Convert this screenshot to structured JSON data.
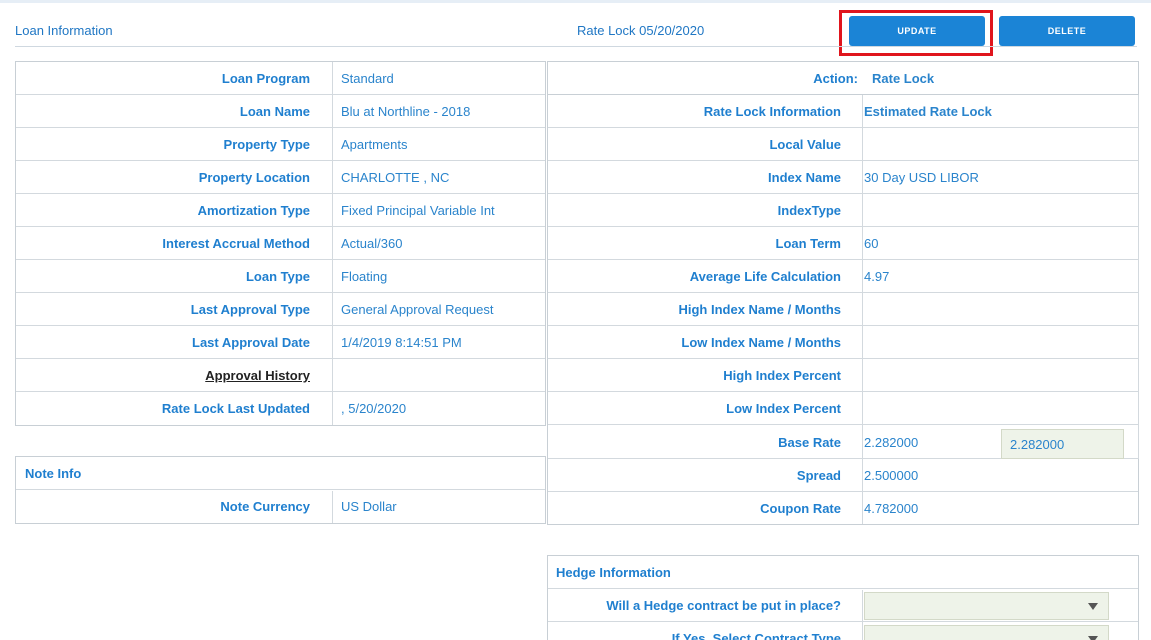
{
  "header": {
    "title": "Loan Information",
    "subtitle": "Rate Lock 05/20/2020",
    "update_label": "UPDATE",
    "delete_label": "DELETE"
  },
  "loan": {
    "rows": [
      {
        "label": "Loan Program",
        "value": "Standard"
      },
      {
        "label": "Loan Name",
        "value": "Blu at Northline - 2018"
      },
      {
        "label": "Property Type",
        "value": "Apartments"
      },
      {
        "label": "Property Location",
        "value": "CHARLOTTE , NC"
      },
      {
        "label": "Amortization Type",
        "value": "Fixed Principal Variable Int"
      },
      {
        "label": "Interest Accrual Method",
        "value": "Actual/360"
      },
      {
        "label": "Loan Type",
        "value": "Floating"
      },
      {
        "label": "Last Approval Type",
        "value": "General Approval Request"
      },
      {
        "label": "Last Approval Date",
        "value": "1/4/2019 8:14:51 PM"
      },
      {
        "label": "Approval History",
        "value": ""
      },
      {
        "label": "Rate Lock Last Updated",
        "value": ", 5/20/2020"
      }
    ]
  },
  "note": {
    "title": "Note Info",
    "currency_label": "Note Currency",
    "currency_value": "US Dollar"
  },
  "rate": {
    "action_label": "Action:",
    "action_value": "Rate Lock",
    "rows": [
      {
        "label": "Rate Lock Information",
        "value": "Estimated Rate Lock"
      },
      {
        "label": "Local Value",
        "value": ""
      },
      {
        "label": "Index Name",
        "value": "30 Day USD LIBOR"
      },
      {
        "label": "IndexType",
        "value": ""
      },
      {
        "label": "Loan Term",
        "value": "60"
      },
      {
        "label": "Average Life Calculation",
        "value": "4.97"
      },
      {
        "label": "High Index Name / Months",
        "value": ""
      },
      {
        "label": "Low Index Name / Months",
        "value": ""
      },
      {
        "label": "High Index Percent",
        "value": ""
      },
      {
        "label": "Low Index Percent",
        "value": ""
      },
      {
        "label": "Base Rate",
        "value": "2.282000"
      },
      {
        "label": "Spread",
        "value": "2.500000"
      },
      {
        "label": "Coupon Rate",
        "value": "4.782000"
      }
    ],
    "base_rate_input": "2.282000"
  },
  "hedge": {
    "title": "Hedge Information",
    "q1_label": "Will a Hedge contract be put in place?",
    "q2_label": "If Yes, Select Contract Type"
  },
  "colors": {
    "accent": "#1b84d6",
    "highlight": "#e0151d",
    "input_bg": "#eef3e9"
  }
}
